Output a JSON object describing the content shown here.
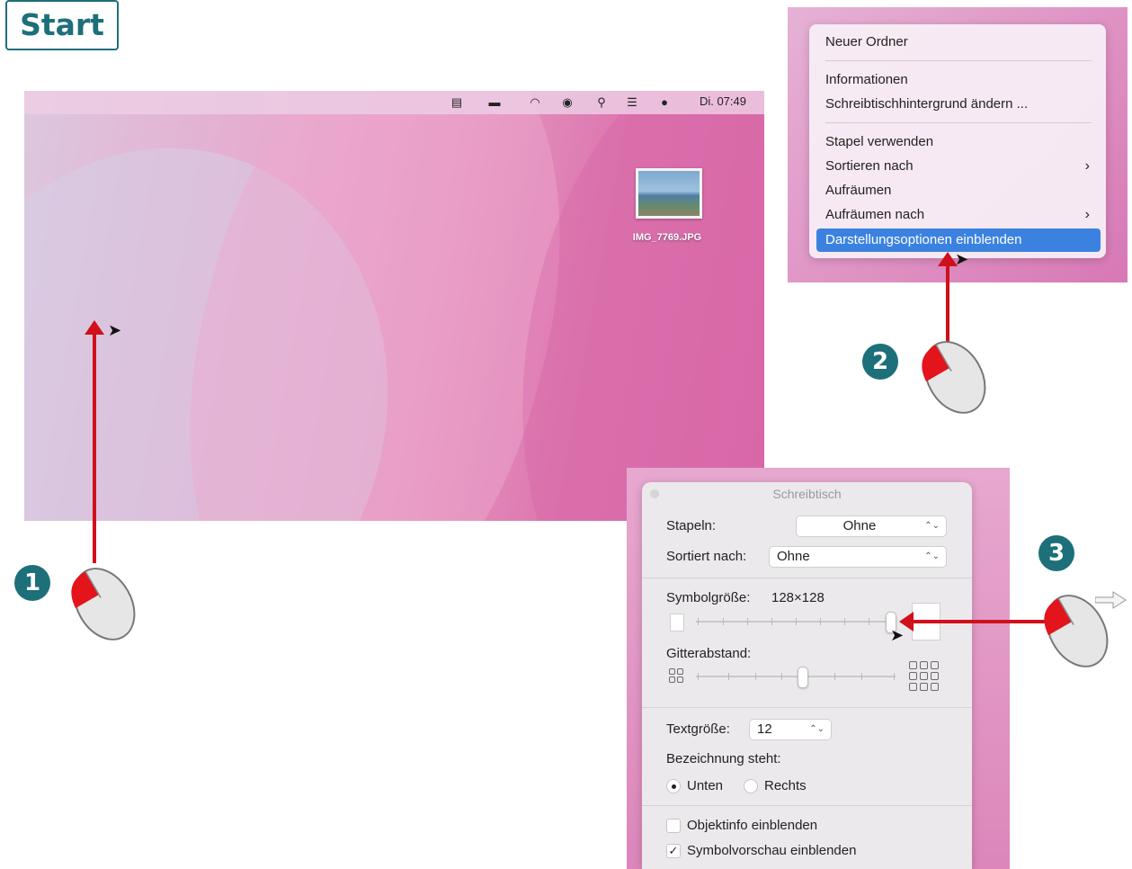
{
  "start_label": "Start",
  "desktop": {
    "clock": "Di. 07:49",
    "menubar_icons": [
      "window-icon",
      "battery-icon",
      "wifi-icon",
      "user-icon",
      "search-icon",
      "control-center-icon",
      "siri-icon"
    ],
    "file_label": "IMG_7769.JPG"
  },
  "context_menu": {
    "items": [
      {
        "label": "Neuer Ordner"
      },
      {
        "label": "Informationen"
      },
      {
        "label": "Schreibtischhintergrund ändern ..."
      },
      {
        "label": "Stapel verwenden"
      },
      {
        "label": "Sortieren nach",
        "chevron": "›"
      },
      {
        "label": "Aufräumen"
      },
      {
        "label": "Aufräumen nach",
        "chevron": "›"
      },
      {
        "label": "Darstellungsoptionen einblenden",
        "highlighted": true
      }
    ]
  },
  "panel": {
    "title": "Schreibtisch",
    "stack_label": "Stapeln:",
    "stack_value": "Ohne",
    "sort_label": "Sortiert nach:",
    "sort_value": "Ohne",
    "icon_size_label": "Symbolgröße:",
    "icon_size_value": "128×128",
    "grid_label": "Gitterabstand:",
    "text_size_label": "Textgröße:",
    "text_size_value": "12",
    "label_pos_label": "Bezeichnung steht:",
    "radio_bottom": "Unten",
    "radio_right": "Rechts",
    "check_info": "Objektinfo einblenden",
    "check_preview": "Symbolvorschau einblenden",
    "check_preview_mark": "✓",
    "select_arrow": "⌃⌄"
  },
  "steps": {
    "one": "1",
    "two": "2",
    "three": "3"
  },
  "colors": {
    "accent": "#1d6f7a",
    "arrow": "#d0101a",
    "highlight": "#3b82e0"
  }
}
